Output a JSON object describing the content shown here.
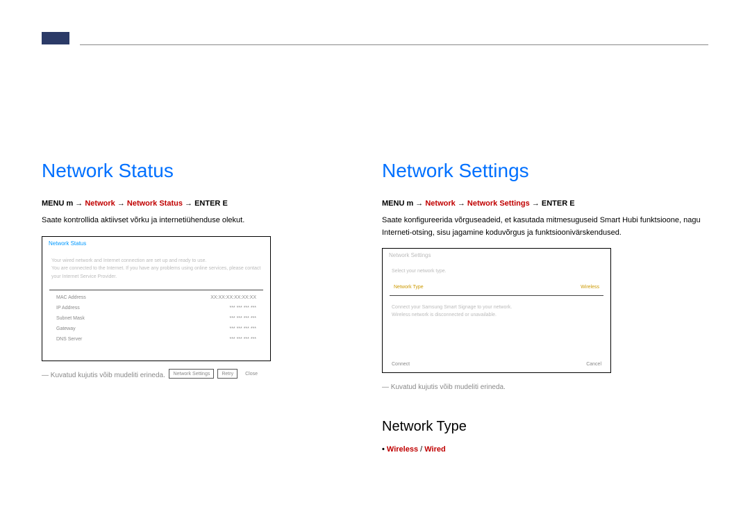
{
  "leftCol": {
    "title": "Network Status",
    "breadcrumb": {
      "menu": "MENU",
      "arrow1": "m",
      "network": "Network",
      "arrow2": "→",
      "current": "Network Status",
      "arrow3": "→",
      "enter": "ENTER",
      "enterIcon": "E"
    },
    "desc": "Saate kontrollida aktiivset võrku ja internetiühenduse olekut.",
    "screenshot": {
      "header": "Network Status",
      "msg1": "Your wired network and Internet connection are set up and ready to use.",
      "msg2": "You are connected to the Internet. If you have any problems using online services, please contact your Internet Service Provider.",
      "macRow": {
        "label": "MAC Address",
        "value": "XX:XX:XX:XX:XX:XX"
      },
      "ipRow": {
        "label": "IP Address",
        "value": "*** *** *** ***"
      },
      "subnetRow": {
        "label": "Subnet Mask",
        "value": "*** *** *** ***"
      },
      "gatewayRow": {
        "label": "Gateway",
        "value": "*** *** *** ***"
      },
      "dnsRow": {
        "label": "DNS Server",
        "value": "*** *** *** ***"
      },
      "btn1": "Network Settings",
      "btn2": "Retry",
      "btn3": "Close"
    },
    "footnote": "― Kuvatud kujutis võib mudeliti erineda."
  },
  "rightCol": {
    "title": "Network Settings",
    "breadcrumb": {
      "menu": "MENU",
      "arrow1": "m",
      "network": "Network",
      "arrow2": "→",
      "current": "Network Settings",
      "arrow3": "→",
      "enter": "ENTER",
      "enterIcon": "E"
    },
    "desc": "Saate konfigureerida võrguseadeid, et kasutada mitmesuguseid Smart Hubi funktsioone, nagu Interneti-otsing, sisu jagamine koduvõrgus ja funktsioonivärskendused.",
    "screenshot": {
      "header": "Network Settings",
      "msg": "Select your network type.",
      "rowLabel": "Network Type",
      "rowValue": "Wireless",
      "connectInfo": "Connect your Samsung Smart Signage to your network.",
      "wirelessInfo": "Wireless network is disconnected or unavailable.",
      "navLeft": "Connect",
      "navRight": "Cancel"
    },
    "footnote": "― Kuvatud kujutis võib mudeliti erineda.",
    "networkType": {
      "heading": "Network Type",
      "dot": "•",
      "item1": "Wireless",
      "sep": " / ",
      "item2": "Wired"
    }
  }
}
